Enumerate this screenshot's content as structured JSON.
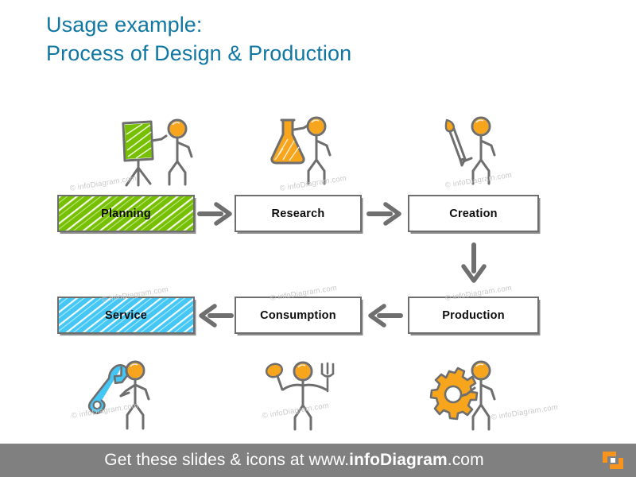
{
  "slide": {
    "title_line1": "Usage example:",
    "title_line2": "Process of Design & Production",
    "title_color": "#1077a3",
    "background": "#ffffff",
    "watermark_text": "© infoDiagram.com"
  },
  "diagram": {
    "type": "process-flow",
    "accent_green": "#76c000",
    "accent_cyan": "#45c7f5",
    "accent_orange": "#f7a51c",
    "outline_gray": "#6e6e6e",
    "arrow_gray": "#6f6f6f",
    "steps": [
      {
        "id": "planning",
        "label": "Planning",
        "fill": "green",
        "row": 1,
        "icon": "flipchart-presenter-icon",
        "icon_position": "above"
      },
      {
        "id": "research",
        "label": "Research",
        "fill": "white",
        "row": 1,
        "icon": "flask-scientist-icon",
        "icon_position": "above"
      },
      {
        "id": "creation",
        "label": "Creation",
        "fill": "white",
        "row": 1,
        "icon": "paintbrush-artist-icon",
        "icon_position": "above"
      },
      {
        "id": "production",
        "label": "Production",
        "fill": "white",
        "row": 2,
        "icon": "gears-worker-icon",
        "icon_position": "below"
      },
      {
        "id": "consumption",
        "label": "Consumption",
        "fill": "white",
        "row": 2,
        "icon": "fork-spoon-consumer-icon",
        "icon_position": "below"
      },
      {
        "id": "service",
        "label": "Service",
        "fill": "cyan",
        "row": 2,
        "icon": "wrench-technician-icon",
        "icon_position": "below"
      }
    ],
    "connectors": [
      {
        "id": "planning-to-research",
        "direction": "right"
      },
      {
        "id": "research-to-creation",
        "direction": "right"
      },
      {
        "id": "creation-to-production",
        "direction": "down"
      },
      {
        "id": "production-to-consumption",
        "direction": "left"
      },
      {
        "id": "consumption-to-service",
        "direction": "left"
      }
    ]
  },
  "footer": {
    "text_prefix": "Get these slides & icons at www.",
    "text_brand": "infoDiagram",
    "text_suffix": ".com",
    "background": "#808080",
    "logo": "infodiagram-logo-icon"
  }
}
